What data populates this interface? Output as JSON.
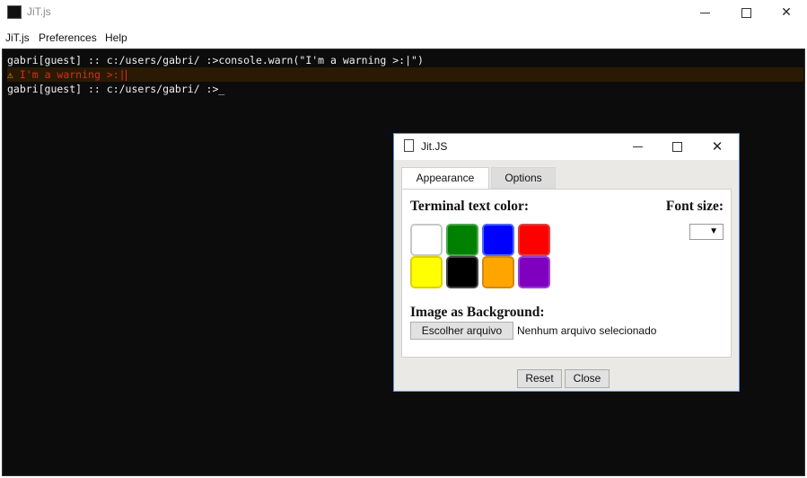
{
  "window": {
    "title": "JiT.js"
  },
  "menu": {
    "items": [
      "JiT.js",
      "Preferences",
      "Help"
    ]
  },
  "terminal": {
    "lines": [
      {
        "text": "gabri[guest] :: c:/users/gabri/ :>console.warn(\"I'm a warning >:|\")",
        "type": "command"
      },
      {
        "icon": "warning-icon",
        "text": "I'm a warning >:|",
        "type": "warning"
      },
      {
        "text": "gabri[guest] :: c:/users/gabri/ :>_",
        "type": "prompt"
      }
    ],
    "colors": {
      "background": "#0c0c0c",
      "text": "#f0f0f0",
      "warning": "#e0281e"
    }
  },
  "dialog": {
    "title": "Jit.JS",
    "tabs": [
      {
        "label": "Appearance",
        "active": true
      },
      {
        "label": "Options",
        "active": false
      }
    ],
    "text_color_label": "Terminal text color:",
    "font_size_label": "Font size:",
    "font_size_value": "",
    "swatches": [
      {
        "name": "white",
        "color": "#ffffff",
        "border": "#c8c8c8"
      },
      {
        "name": "green",
        "color": "#008000",
        "border": "#4aa84a"
      },
      {
        "name": "blue",
        "color": "#0000ff",
        "border": "#4a6aff"
      },
      {
        "name": "red",
        "color": "#ff0000",
        "border": "#e04040"
      },
      {
        "name": "yellow",
        "color": "#ffff00",
        "border": "#e0d000"
      },
      {
        "name": "black",
        "color": "#000000",
        "border": "#444444"
      },
      {
        "name": "orange",
        "color": "#ffa500",
        "border": "#d08a10"
      },
      {
        "name": "purple",
        "color": "#8000c0",
        "border": "#9a40d0"
      }
    ],
    "image_label": "Image as Background:",
    "file_button": "Escolher arquivo",
    "file_status": "Nenhum arquivo selecionado",
    "buttons": {
      "reset": "Reset",
      "close": "Close"
    }
  }
}
